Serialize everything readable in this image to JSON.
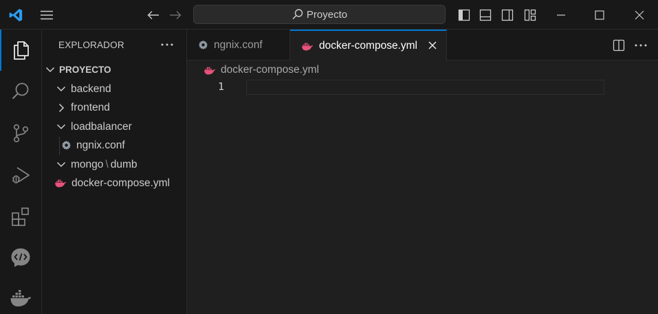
{
  "titlebar": {
    "search_text": "Proyecto"
  },
  "activity_bar": {
    "items": [
      {
        "name": "explorer",
        "icon": "files-icon",
        "active": true
      },
      {
        "name": "search",
        "icon": "search-icon",
        "active": false
      },
      {
        "name": "source-control",
        "icon": "source-control-icon",
        "active": false
      },
      {
        "name": "run-debug",
        "icon": "run-debug-icon",
        "active": false
      },
      {
        "name": "extensions",
        "icon": "extensions-icon",
        "active": false
      },
      {
        "name": "live-share",
        "icon": "code-chat-icon",
        "active": false
      },
      {
        "name": "docker",
        "icon": "docker-icon",
        "active": false
      }
    ]
  },
  "sidebar": {
    "header": "EXPLORADOR",
    "root": "PROYECTO",
    "items": [
      {
        "label": "backend",
        "type": "folder",
        "expanded": true
      },
      {
        "label": "frontend",
        "type": "folder",
        "expanded": false
      },
      {
        "label": "loadbalancer",
        "type": "folder",
        "expanded": true
      },
      {
        "label": "ngnix.conf",
        "type": "file",
        "icon": "gear-icon"
      },
      {
        "label": "mongo",
        "sep": "\\",
        "label2": "dumb",
        "type": "folder",
        "expanded": true
      },
      {
        "label": "docker-compose.yml",
        "type": "file",
        "icon": "docker-icon"
      }
    ]
  },
  "tabs": [
    {
      "label": "ngnix.conf",
      "icon": "gear-icon",
      "active": false
    },
    {
      "label": "docker-compose.yml",
      "icon": "docker-icon",
      "active": true
    }
  ],
  "editor": {
    "breadcrumb": "docker-compose.yml",
    "line_number": "1"
  },
  "colors": {
    "accent": "#0078d4",
    "docker_pink": "#e8527a",
    "background": "#1f1f1f",
    "panel": "#181818"
  }
}
